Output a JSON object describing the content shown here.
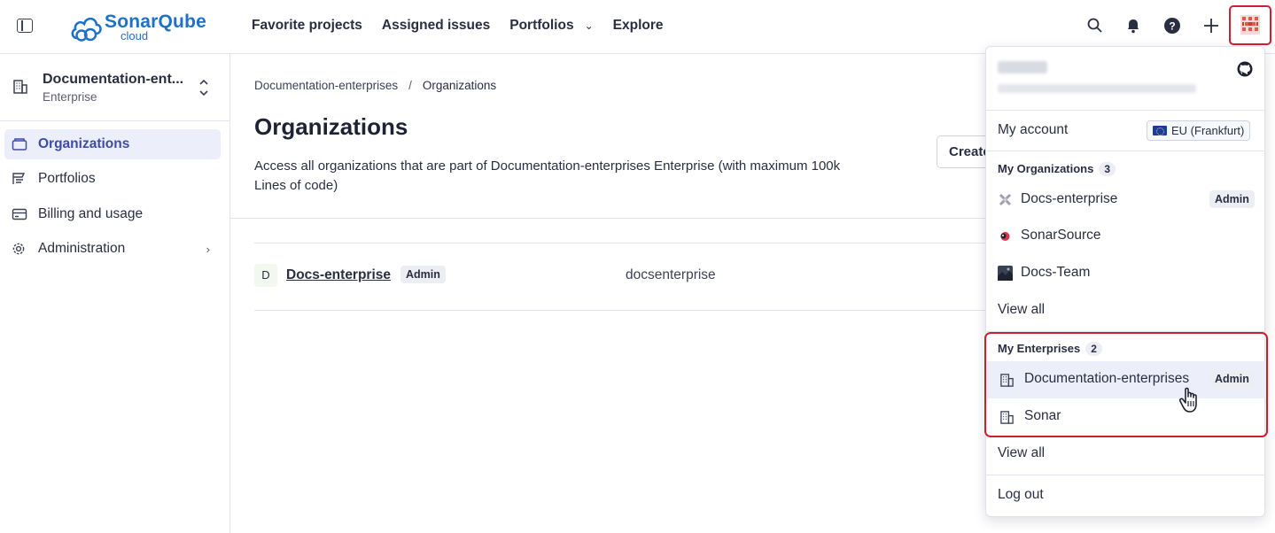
{
  "header": {
    "logo_main": "SonarQube",
    "logo_sub": "cloud",
    "nav": [
      {
        "label": "Favorite projects"
      },
      {
        "label": "Assigned issues"
      },
      {
        "label": "Portfolios"
      },
      {
        "label": "Explore"
      }
    ]
  },
  "sidebar": {
    "enterprise_name": "Documentation-ent...",
    "enterprise_type": "Enterprise",
    "items": [
      {
        "label": "Organizations",
        "active": true
      },
      {
        "label": "Portfolios"
      },
      {
        "label": "Billing and usage"
      },
      {
        "label": "Administration"
      }
    ]
  },
  "main": {
    "breadcrumb": [
      "Documentation-enterprises",
      "/",
      "Organizations"
    ],
    "title": "Organizations",
    "description": "Access all organizations that are part of Documentation-enterprises Enterprise (with maximum 100k Lines of code)",
    "create_label": "Create",
    "rows": [
      {
        "initial": "D",
        "name": "Docs-enterprise",
        "role": "Admin",
        "key": "docsenterprise"
      }
    ]
  },
  "dropdown": {
    "my_account": "My account",
    "region": "EU (Frankfurt)",
    "orgs_heading": "My Organizations",
    "orgs_count": "3",
    "orgs": [
      {
        "name": "Docs-enterprise",
        "role": "Admin"
      },
      {
        "name": "SonarSource"
      },
      {
        "name": "Docs-Team"
      }
    ],
    "view_all_orgs": "View all",
    "ents_heading": "My Enterprises",
    "ents_count": "2",
    "ents": [
      {
        "name": "Documentation-enterprises",
        "role": "Admin"
      },
      {
        "name": "Sonar"
      }
    ],
    "view_all_ents": "View all",
    "logout": "Log out"
  },
  "colors": {
    "brand": "#1e71c7",
    "accent": "#3e4ca8",
    "highlight": "#c8202e"
  }
}
